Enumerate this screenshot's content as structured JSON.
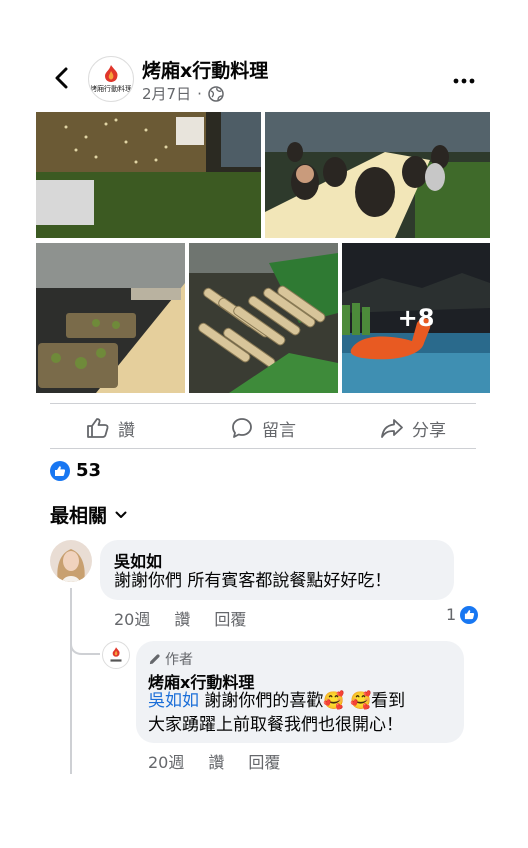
{
  "header": {
    "back_icon": "chevron-left-icon",
    "page_name": "烤廂x行動料理",
    "date": "2月7日",
    "separator": "·",
    "audience_icon": "globe-icon",
    "more_icon": "more-horizontal-icon",
    "logo_text": "烤廂行動料理"
  },
  "photos": {
    "more_count": "+8"
  },
  "actions": {
    "like_label": "讚",
    "comment_label": "留言",
    "share_label": "分享"
  },
  "reactions": {
    "count": "53"
  },
  "comments_section": {
    "sort_label": "最相關"
  },
  "comment": {
    "author": "吳如如",
    "text": "謝謝你們 所有賓客都說餐點好好吃！",
    "time": "20週",
    "like_label": "讚",
    "reply_label": "回覆",
    "reaction_count": "1"
  },
  "reply": {
    "author_tag": "作者",
    "author": "烤廂x行動料理",
    "mention": "吳如如",
    "text_part1": " 謝謝你們的喜歡",
    "emoji": "🥰 🥰",
    "text_part2": "看到",
    "text_line2": "大家踴躍上前取餐我們也很開心！",
    "time": "20週",
    "like_label": "讚",
    "reply_label": "回覆"
  },
  "colors": {
    "accent": "#1877f2",
    "mention": "#1a6ed8",
    "secondary_text": "#65676b",
    "bubble": "#f0f2f5"
  }
}
